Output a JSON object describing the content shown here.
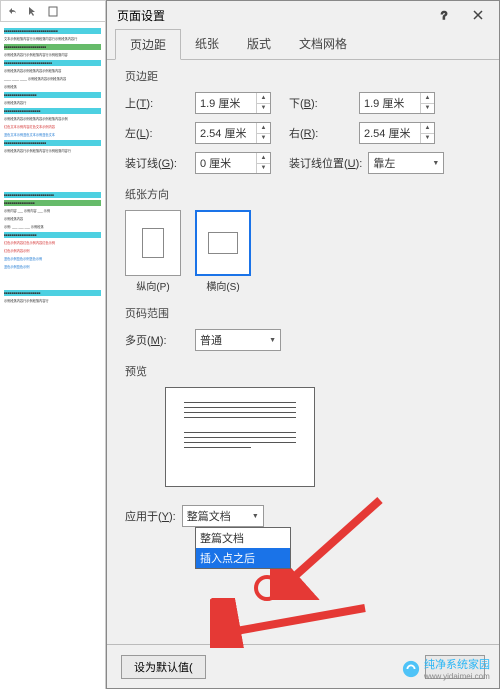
{
  "toolbar_icons": [
    "undo",
    "cursor",
    "clipboard"
  ],
  "dialog": {
    "title": "页面设置",
    "tabs": [
      "页边距",
      "纸张",
      "版式",
      "文档网格"
    ],
    "active_tab": 0,
    "margins": {
      "section": "页边距",
      "top_label": "上(T):",
      "top_value": "1.9 厘米",
      "bottom_label": "下(B):",
      "bottom_value": "1.9 厘米",
      "left_label": "左(L):",
      "left_value": "2.54 厘米",
      "right_label": "右(R):",
      "right_value": "2.54 厘米",
      "gutter_label": "装订线(G):",
      "gutter_value": "0 厘米",
      "gutter_pos_label": "装订线位置(U):",
      "gutter_pos_value": "靠左"
    },
    "orientation": {
      "section": "纸张方向",
      "portrait": "纵向(P)",
      "landscape": "横向(S)",
      "selected": "landscape"
    },
    "pages": {
      "section": "页码范围",
      "multi_label": "多页(M):",
      "multi_value": "普通"
    },
    "preview": {
      "section": "预览"
    },
    "apply": {
      "label": "应用于(Y):",
      "value": "整篇文档",
      "options": [
        "整篇文档",
        "插入点之后"
      ],
      "highlighted": 1
    },
    "footer": {
      "default_btn": "设为默认值("
    }
  },
  "watermark": {
    "text": "纯净系统家园",
    "url": "www.yidaimei.com"
  },
  "annotation_color": "#e53935"
}
